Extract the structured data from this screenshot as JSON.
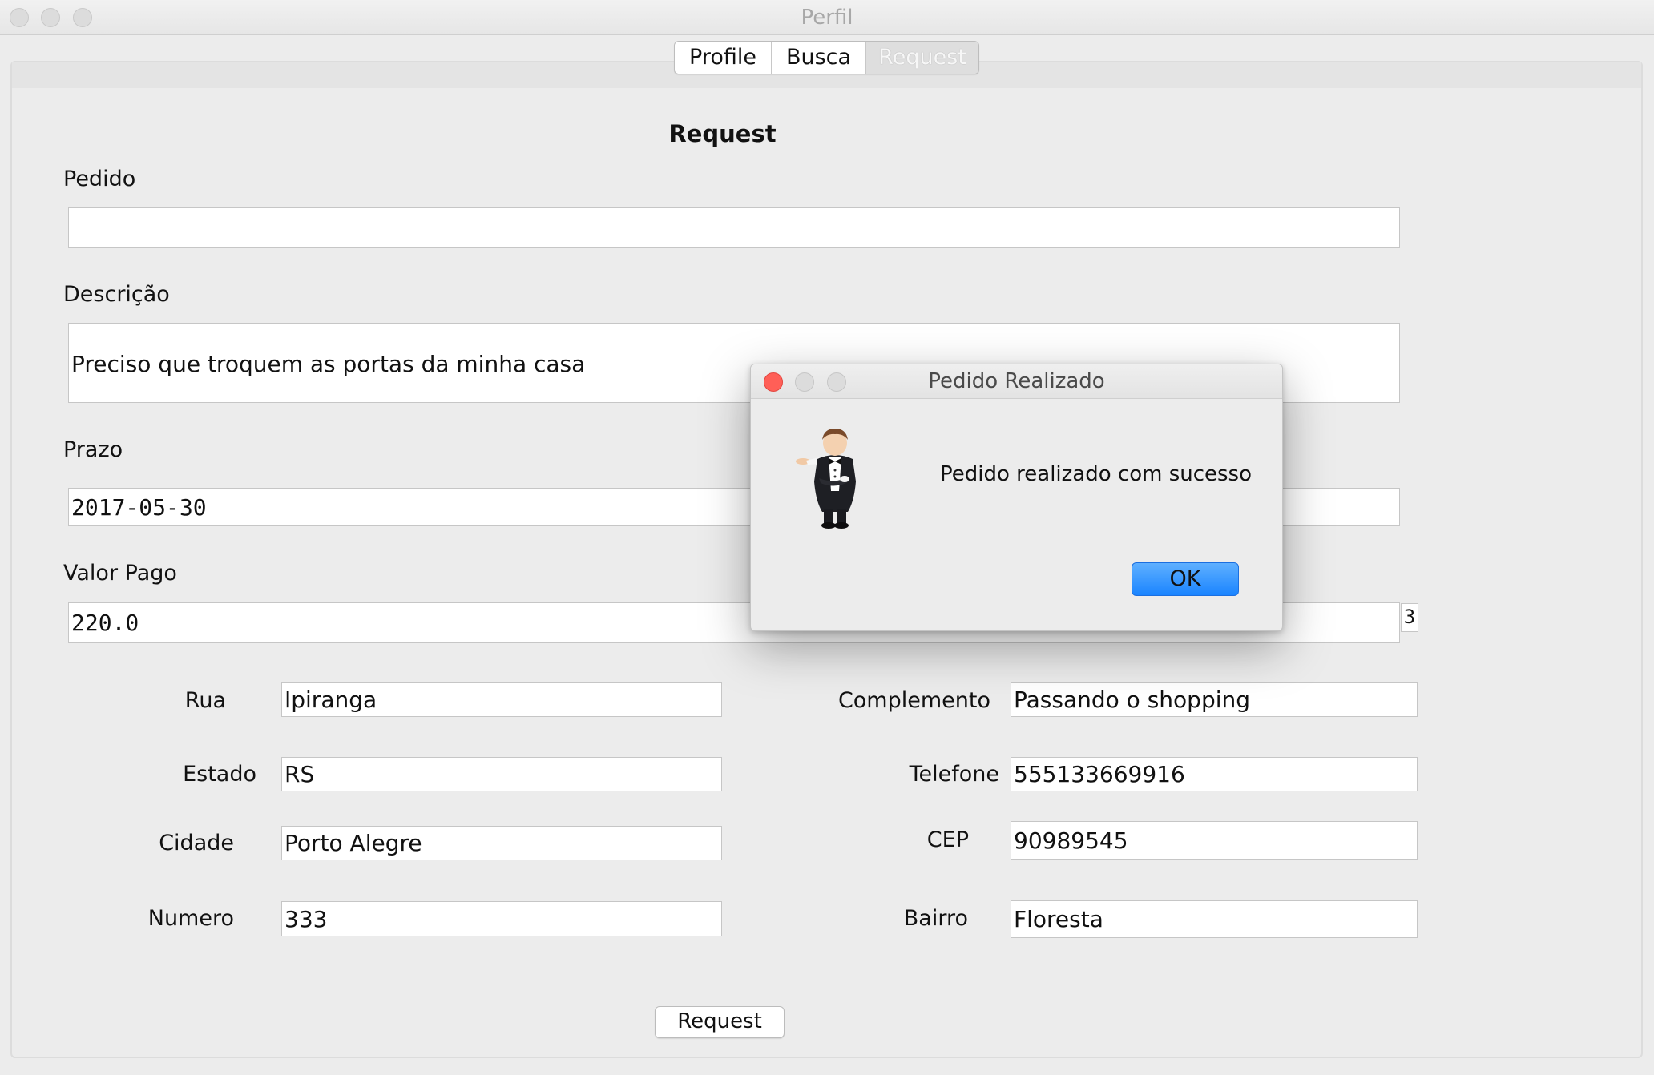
{
  "window": {
    "title": "Perfil"
  },
  "tabs": [
    {
      "label": "Profile",
      "selected": false
    },
    {
      "label": "Busca",
      "selected": false
    },
    {
      "label": "Request",
      "selected": true
    }
  ],
  "form": {
    "heading": "Request",
    "pedido": {
      "label": "Pedido",
      "value": ""
    },
    "descricao": {
      "label": "Descrição",
      "value": "Preciso que troquem as portas da minha casa"
    },
    "prazo": {
      "label": "Prazo",
      "value": "2017-05-30"
    },
    "valor_pago": {
      "label": "Valor Pago",
      "value": "220.0"
    },
    "side_box_value": "3",
    "address": {
      "rua": {
        "label": "Rua",
        "value": "Ipiranga"
      },
      "estado": {
        "label": "Estado",
        "value": "RS"
      },
      "cidade": {
        "label": "Cidade",
        "value": "Porto Alegre"
      },
      "numero": {
        "label": "Numero",
        "value": "333"
      },
      "complemento": {
        "label": "Complemento",
        "value": "Passando o shopping"
      },
      "telefone": {
        "label": "Telefone",
        "value": "555133669916"
      },
      "cep": {
        "label": "CEP",
        "value": "90989545"
      },
      "bairro": {
        "label": "Bairro",
        "value": "Floresta"
      }
    },
    "submit_label": "Request"
  },
  "dialog": {
    "title": "Pedido Realizado",
    "message": "Pedido realizado com sucesso",
    "ok_label": "OK",
    "icon": "butler-icon"
  },
  "colors": {
    "ok_button": "#1a84ff",
    "close_dot": "#ff5f57",
    "background": "#ececec"
  }
}
